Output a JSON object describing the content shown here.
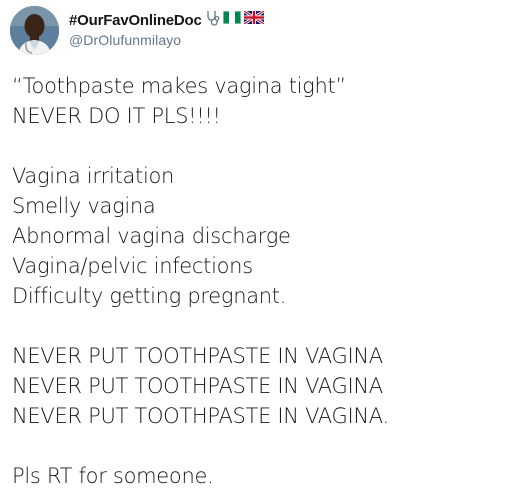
{
  "author": {
    "display_name": "#OurFavOnlineDoc",
    "handle": "@DrOlufunmilayo",
    "name_icons": [
      "stethoscope-icon",
      "nigeria-flag-icon",
      "uk-flag-icon"
    ]
  },
  "tweet": {
    "lines": [
      "“Toothpaste makes vagina tight”",
      "NEVER DO IT PLS!!!!",
      "",
      "Vagina irritation",
      "Smelly vagina",
      "Abnormal vagina discharge",
      "Vagina/pelvic infections",
      "Difficulty getting pregnant.",
      "",
      "NEVER PUT TOOTHPASTE IN VAGINA",
      "NEVER PUT TOOTHPASTE IN VAGINA",
      "NEVER PUT TOOTHPASTE IN VAGINA.",
      "",
      "Pls RT for someone."
    ]
  },
  "colors": {
    "text": "#14171a",
    "secondary_text": "#657786",
    "nigeria_green": "#008751",
    "uk_blue": "#012169",
    "uk_red": "#c8102e"
  }
}
